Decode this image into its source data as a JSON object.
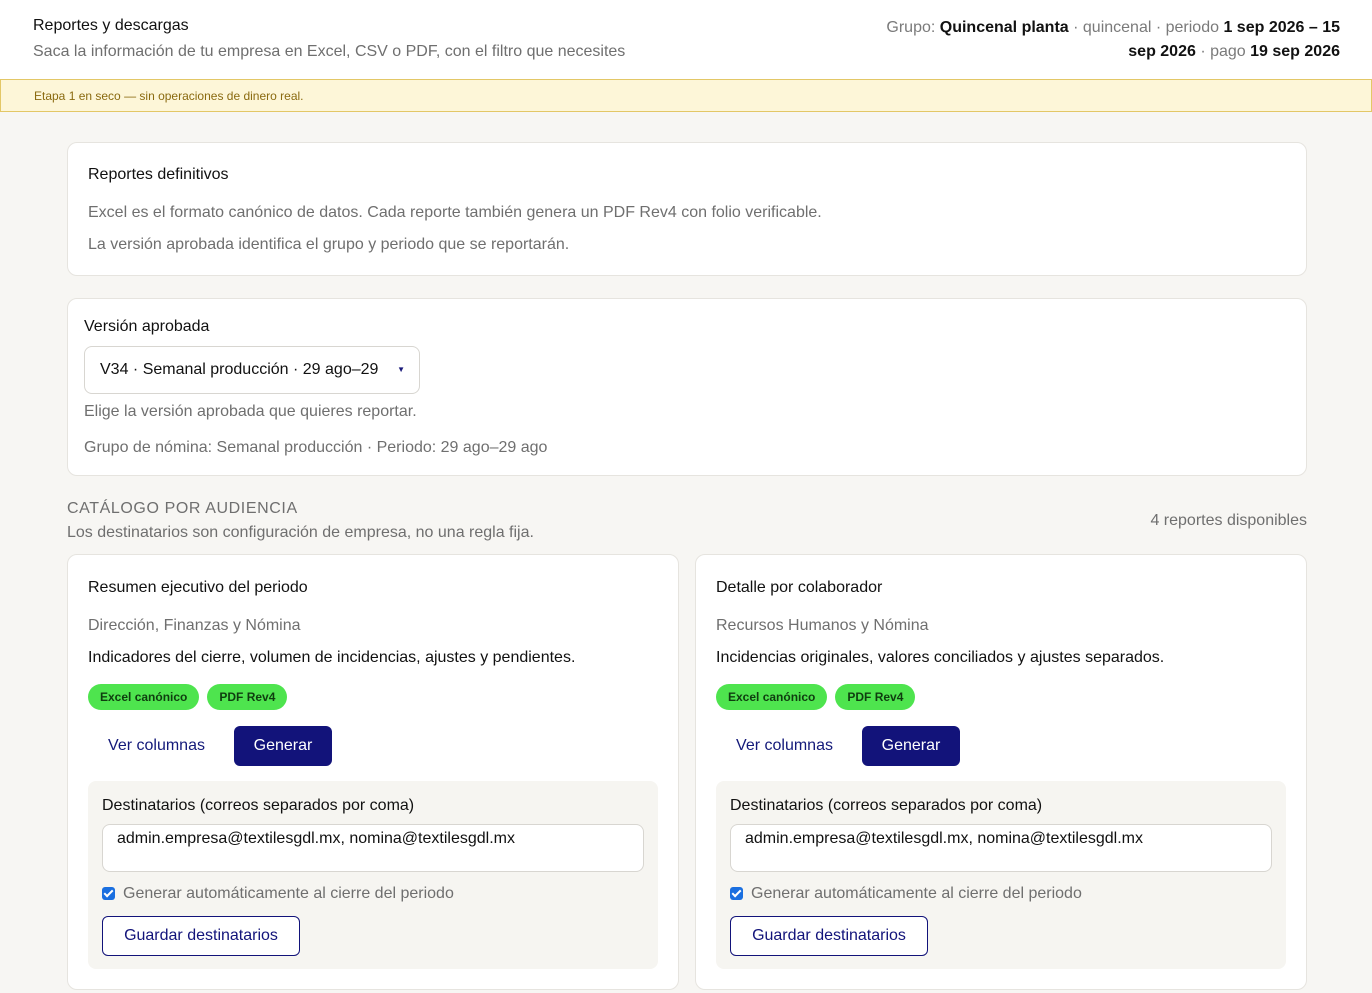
{
  "header": {
    "title": "Reportes y descargas",
    "subtitle": "Saca la información de tu empresa en Excel, CSV o PDF, con el filtro que necesites",
    "context": {
      "group_label": "Grupo: ",
      "group": "Quincenal planta",
      "sep1": " · quincenal · periodo ",
      "period": "1 sep 2026 – 15 sep 2026",
      "sep2": " · pago ",
      "pay_date": "19 sep 2026"
    }
  },
  "banner": {
    "text": "Etapa 1 en seco — sin operaciones de dinero real."
  },
  "definitive": {
    "title": "Reportes definitivos",
    "line1": "Excel es el formato canónico de datos. Cada reporte también genera un PDF Rev4 con folio verificable.",
    "line2": "La versión aprobada identifica el grupo y periodo que se reportarán."
  },
  "version": {
    "label": "Versión aprobada",
    "selected": "V34 · Semanal producción · 29 ago–29",
    "help": "Elige la versión aprobada que quieres reportar.",
    "meta": "Grupo de nómina: Semanal producción · Periodo: 29 ago–29 ago"
  },
  "catalog": {
    "title": "CATÁLOGO POR AUDIENCIA",
    "subtitle": "Los destinatarios son configuración de empresa, no una regla fija.",
    "count": "4 reportes disponibles"
  },
  "reports": [
    {
      "name": "Resumen ejecutivo del periodo",
      "audience": "Dirección, Finanzas y Nómina",
      "description": "Indicadores del cierre, volumen de incidencias, ajustes y pendientes.",
      "tags": [
        "Excel canónico",
        "PDF Rev4"
      ],
      "view_columns": "Ver columnas",
      "generate": "Generar",
      "recipients_label": "Destinatarios (correos separados por coma)",
      "recipients_value": "admin.empresa@textilesgdl.mx, nomina@textilesgdl.mx",
      "auto_label": "Generar automáticamente al cierre del periodo",
      "auto_checked": true,
      "save": "Guardar destinatarios"
    },
    {
      "name": "Detalle por colaborador",
      "audience": "Recursos Humanos y Nómina",
      "description": "Incidencias originales, valores conciliados y ajustes separados.",
      "tags": [
        "Excel canónico",
        "PDF Rev4"
      ],
      "view_columns": "Ver columnas",
      "generate": "Generar",
      "recipients_label": "Destinatarios (correos separados por coma)",
      "recipients_value": "admin.empresa@textilesgdl.mx, nomina@textilesgdl.mx",
      "auto_label": "Generar automáticamente al cierre del periodo",
      "auto_checked": true,
      "save": "Guardar destinatarios"
    }
  ]
}
